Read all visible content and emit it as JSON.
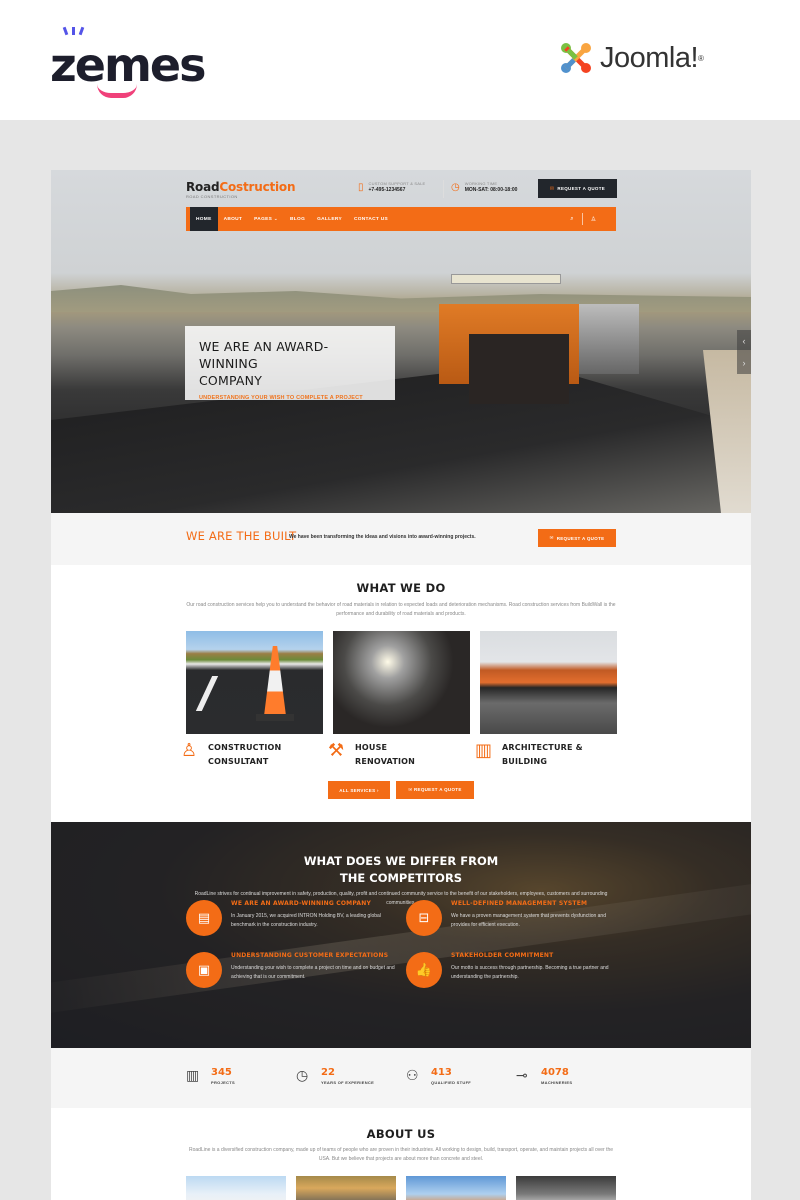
{
  "banner": {
    "zemes_logo": "zemes",
    "joomla_logo": "Joomla!",
    "joomla_reg": "®"
  },
  "site": {
    "logo_main": "Road",
    "logo_accent": "Costruction",
    "logo_sub": "ROAD CONSTRUCTION",
    "support_label": "CUSTOM SUPPORT & SALE",
    "support_phone": "+7-495-1234567",
    "hours_label": "WORKING TIME",
    "hours_value": "MON-SAT: 08:00-18:00",
    "quote_button": "REQUEST A QUOTE"
  },
  "nav": {
    "items": [
      {
        "label": "HOME",
        "active": true
      },
      {
        "label": "ABOUT"
      },
      {
        "label": "PAGES ⌄"
      },
      {
        "label": "BLOG"
      },
      {
        "label": "GALLERY"
      },
      {
        "label": "CONTACT US"
      }
    ],
    "search_icon": "⌕",
    "user_icon": "♙"
  },
  "hero": {
    "title_line1": "WE ARE AN AWARD-WINNING",
    "title_line2": "COMPANY",
    "subtitle": "UNDERSTANDING YOUR WISH TO COMPLETE A PROJECT",
    "prev_arrow": "‹",
    "next_arrow": "›"
  },
  "built": {
    "title": "WE ARE THE BUILT",
    "text": "We have been transforming the ideas and visions into award-winning projects.",
    "button": "REQUEST A QUOTE"
  },
  "what_we_do": {
    "title": "WHAT WE DO",
    "text": "Our road construction services help you to understand the behavior of road materials in relation to expected loads and deterioration mechanisms. Road construction services from BuildWall is the performance and durability of road materials and products.",
    "services": [
      {
        "line1": "CONSTRUCTION",
        "line2": "CONSULTANT",
        "icon": "♙"
      },
      {
        "line1": "HOUSE",
        "line2": "RENOVATION",
        "icon": "⚒"
      },
      {
        "line1": "ARCHITECTURE &",
        "line2": "BUILDING",
        "icon": "▥"
      }
    ],
    "all_services_button": "ALL SERVICES  ›",
    "quote_button": "✉  REQUEST A QUOTE"
  },
  "differ": {
    "title_line1": "WHAT DOES WE DIFFER FROM",
    "title_line2": "THE COMPETITORS",
    "text": "RoadLine strives for continual improvement in safety, production, quality, profit and continued community service to the benefit of our stakeholders, employees, customers and surrounding communities.",
    "features": [
      {
        "title": "WE ARE AN AWARD-WINNING COMPANY",
        "text": "In January 2015, we acquired INTRON Holding BV, a leading global benchmark in the construction industry.",
        "icon": "▤"
      },
      {
        "title": "WELL-DEFINED MANAGEMENT SYSTEM",
        "text": "We have a proven management system that prevents dysfunction and provides for efficient execution.",
        "icon": "⊟"
      },
      {
        "title": "UNDERSTANDING CUSTOMER EXPECTATIONS",
        "text": "Understanding your wish to complete a project on time and on budget and achieving that is our commitment.",
        "icon": "▣"
      },
      {
        "title": "STAKEHOLDER COMMITMENT",
        "text": "Our motto is success through partnership. Becoming a true partner and understanding the partnership.",
        "icon": "👍"
      }
    ]
  },
  "stats": [
    {
      "number": "345",
      "label": "PROJECTS",
      "icon": "▥"
    },
    {
      "number": "22",
      "label": "YEARS OF EXPERIENCE",
      "icon": "◷"
    },
    {
      "number": "413",
      "label": "QUALIFIED STUFF",
      "icon": "⚇"
    },
    {
      "number": "4078",
      "label": "MACHINERIES",
      "icon": "⊸"
    }
  ],
  "about": {
    "title": "ABOUT US",
    "text": "RoadLine is a diversified construction company, made up of teams of people who are proven in their industries. All working to design, build, transport, operate, and maintain projects all over the USA. But we believe that projects are about more than concrete and steel."
  }
}
